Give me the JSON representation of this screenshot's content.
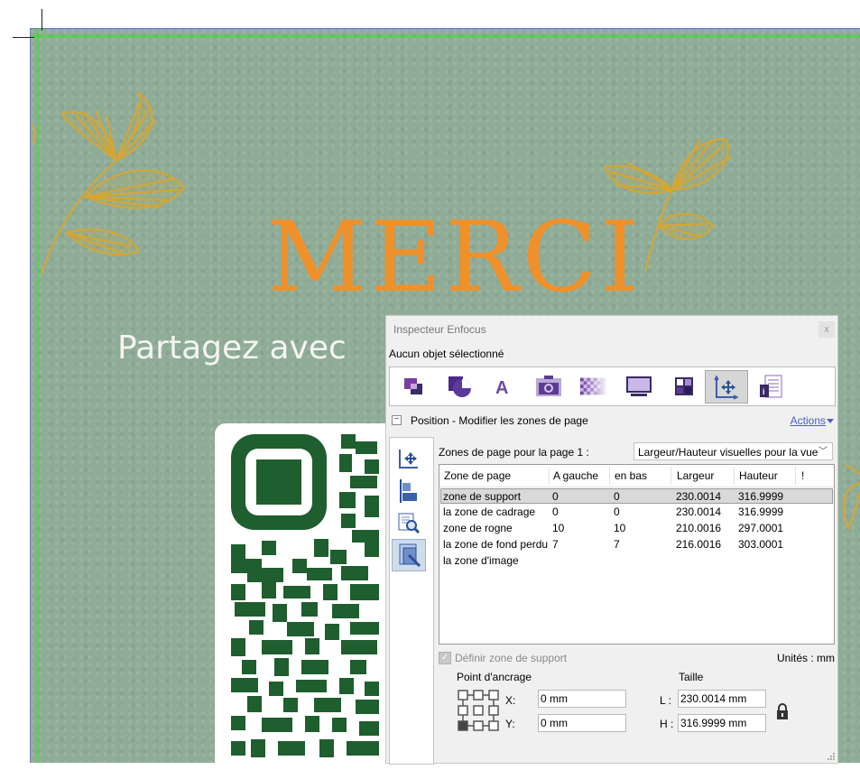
{
  "document": {
    "headline": "MERCI",
    "subline": "Partagez avec"
  },
  "inspector": {
    "title": "Inspecteur Enfocus",
    "close_label": "x",
    "selection_status": "Aucun objet sélectionné",
    "toolbar_icons": [
      "object-icon",
      "shape-icon",
      "text-icon",
      "image-icon",
      "transparency-icon",
      "monitor-icon",
      "color-grid-icon",
      "position-icon",
      "document-info-icon"
    ],
    "section_title": "Position - Modifier les zones de page",
    "actions_label": "Actions",
    "side_icons": [
      "move-icon",
      "align-icon",
      "zoom-page-icon",
      "page-boxes-icon"
    ],
    "zones_label": "Zones de page pour la page 1 :",
    "zones_select_value": "Largeur/Hauteur visuelles pour la vue",
    "table": {
      "columns": [
        "Zone de page",
        "A gauche",
        "en bas",
        "Largeur",
        "Hauteur",
        "!"
      ],
      "rows": [
        [
          "zone de support",
          "0",
          "0",
          "230.0014",
          "316.9999"
        ],
        [
          "la zone de cadrage",
          "0",
          "0",
          "230.0014",
          "316.9999"
        ],
        [
          "zone de rogne",
          "10",
          "10",
          "210.0016",
          "297.0001"
        ],
        [
          "la zone de fond perdu",
          "7",
          "7",
          "216.0016",
          "303.0001"
        ],
        [
          "la zone d'image",
          "",
          "",
          "",
          ""
        ]
      ],
      "selected_row": 0
    },
    "define_support_label": "Définir zone de support",
    "define_support_checked": true,
    "units_label": "Unités : mm",
    "anchor_label": "Point d'ancrage",
    "size_label": "Taille",
    "x_label": "X:",
    "x_value": "0 mm",
    "y_label": "Y:",
    "y_value": "0 mm",
    "l_label": "L :",
    "l_value": "230.0014 mm",
    "h_label": "H :",
    "h_value": "316.9999 mm"
  },
  "colors": {
    "page_background": "#8fac97",
    "headline": "#f0902a",
    "qr_module": "#1f5e2e",
    "gold": "#d7a630",
    "link": "#4a5fc8"
  }
}
